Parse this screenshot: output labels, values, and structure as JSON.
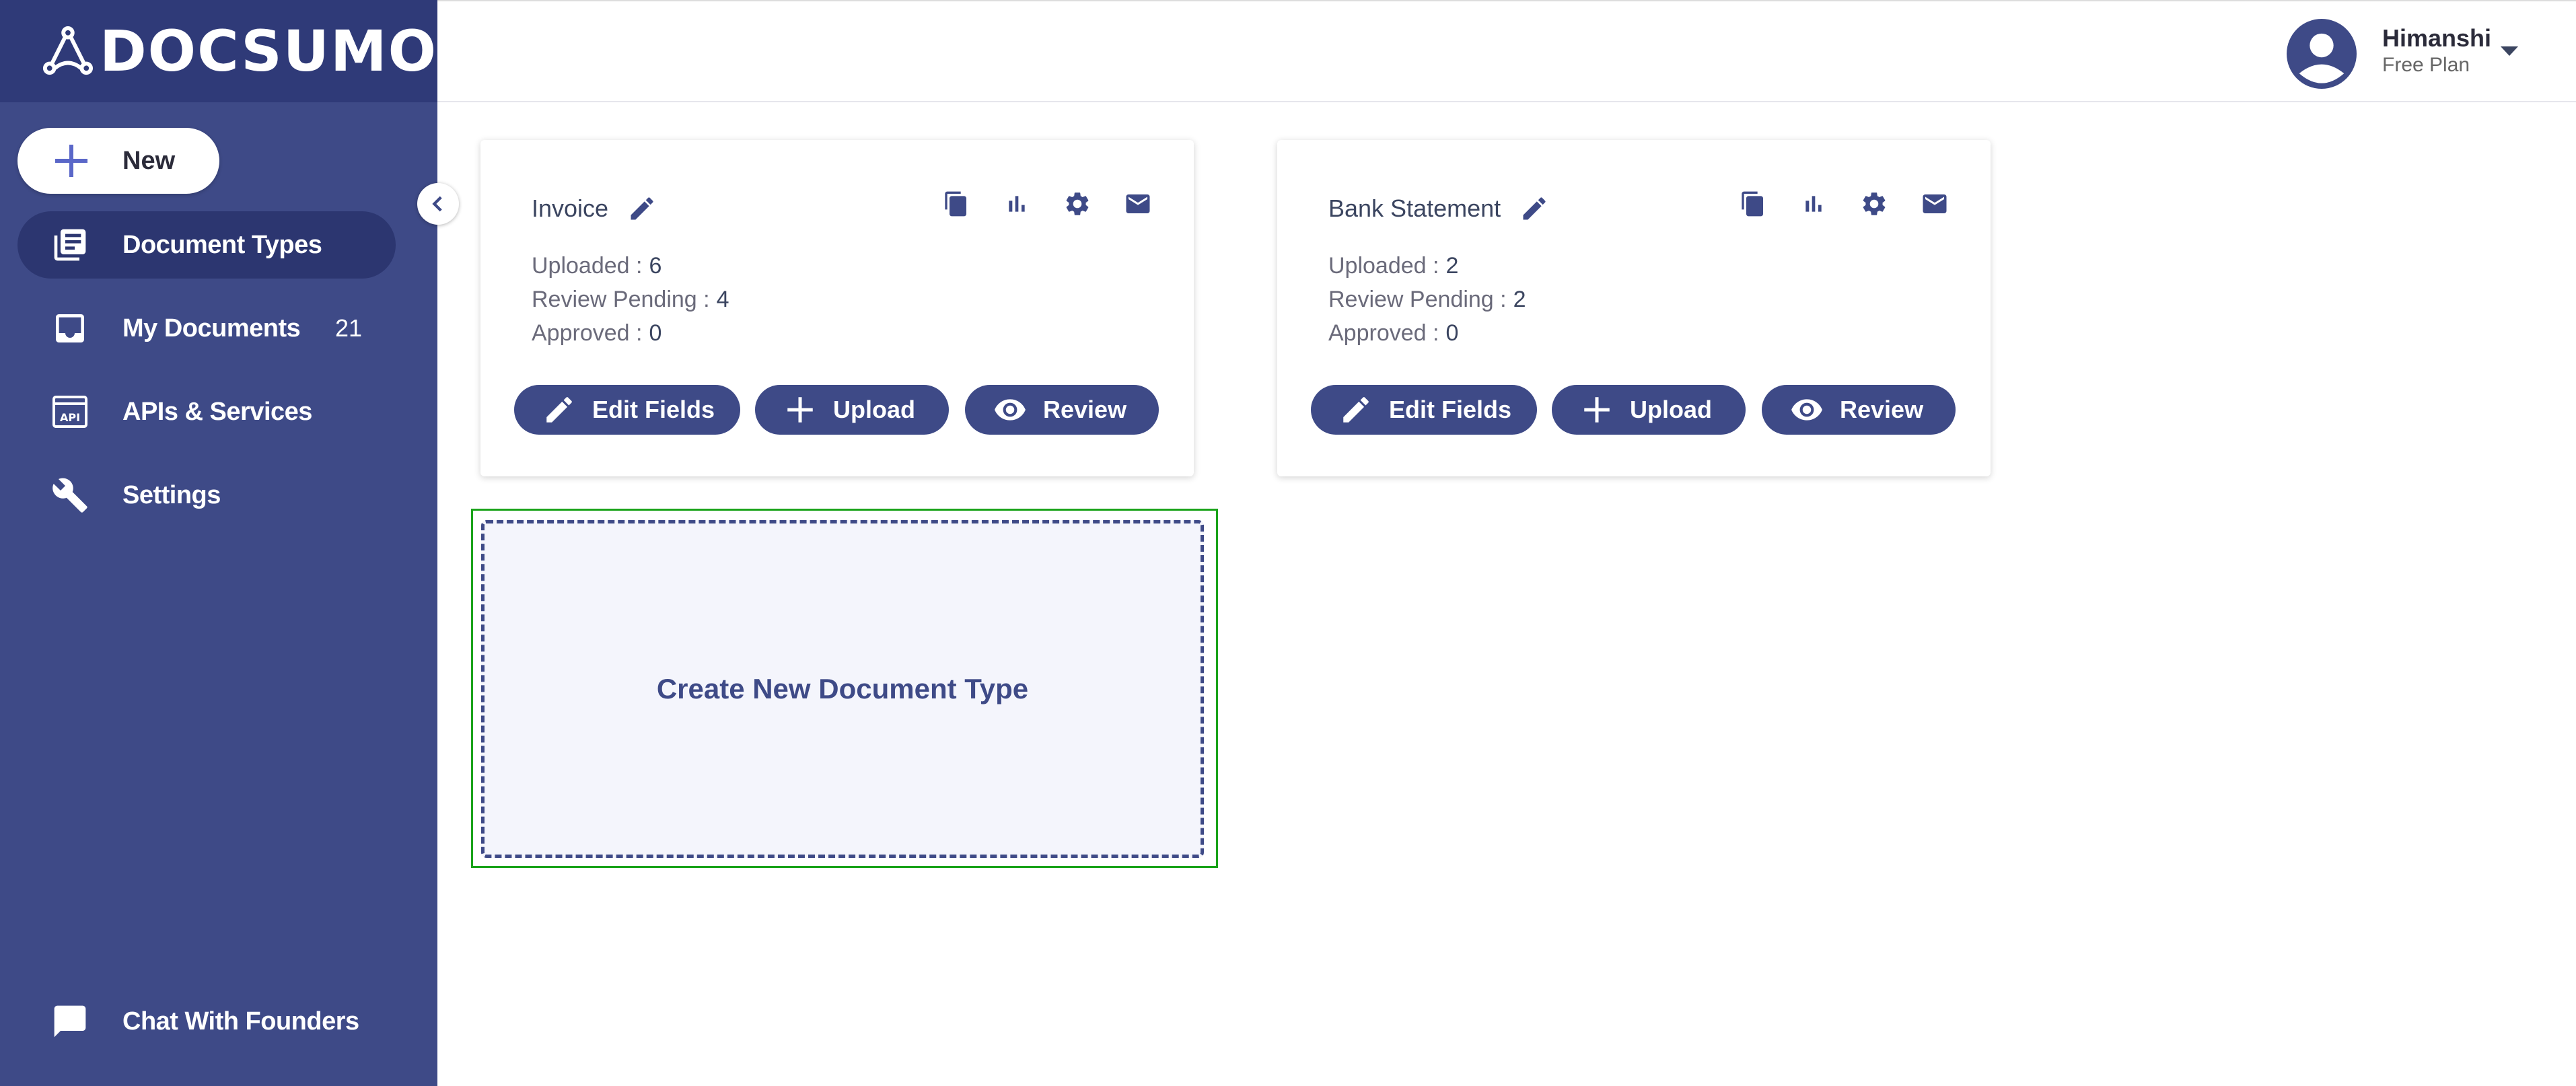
{
  "app": {
    "logo_text": "DOCSUMO"
  },
  "sidebar": {
    "new_label": "New",
    "items": [
      {
        "label": "Document Types",
        "active": true
      },
      {
        "label": "My Documents",
        "count": "21"
      },
      {
        "label": "APIs & Services"
      },
      {
        "label": "Settings"
      }
    ],
    "bottom_label": "Chat With Founders"
  },
  "user": {
    "name": "Himanshi",
    "plan": "Free Plan"
  },
  "cards": [
    {
      "title": "Invoice",
      "uploaded_label": "Uploaded :",
      "uploaded": "6",
      "review_label": "Review Pending :",
      "review": "4",
      "approved_label": "Approved :",
      "approved": "0",
      "btn_edit": "Edit Fields",
      "btn_upload": "Upload",
      "btn_review": "Review"
    },
    {
      "title": "Bank Statement",
      "uploaded_label": "Uploaded :",
      "uploaded": "2",
      "review_label": "Review Pending :",
      "review": "2",
      "approved_label": "Approved :",
      "approved": "0",
      "btn_edit": "Edit Fields",
      "btn_upload": "Upload",
      "btn_review": "Review"
    }
  ],
  "create_new_label": "Create New Document Type",
  "colors": {
    "sidebar": "#3e4a87",
    "logo_bar": "#2f3a78",
    "active_item": "#2c3670",
    "accent": "#3e4a87",
    "selection": "#1aa31a"
  },
  "icons": [
    "logo-icon",
    "plus-icon",
    "document-types-icon",
    "inbox-icon",
    "api-icon",
    "tools-icon",
    "chat-icon",
    "chevron-left-icon",
    "user-avatar-icon",
    "caret-down-icon",
    "pencil-icon",
    "copy-icon",
    "bar-chart-icon",
    "gear-icon",
    "mail-icon",
    "eye-icon"
  ]
}
